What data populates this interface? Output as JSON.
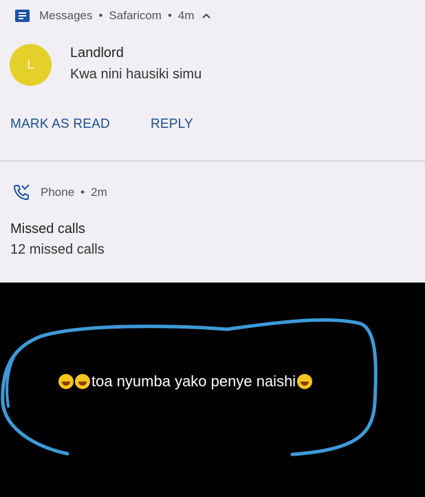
{
  "messages_notification": {
    "app_name": "Messages",
    "carrier": "Safaricom",
    "time": "4m",
    "expand_glyph": "^",
    "avatar_letter": "L",
    "sender": "Landlord",
    "message": "Kwa nini hausiki simu",
    "actions": [
      "MARK AS READ",
      "REPLY"
    ]
  },
  "phone_notification": {
    "app_name": "Phone",
    "time": "2m",
    "title": "Missed calls",
    "subtitle": "12 missed calls"
  },
  "caption": {
    "text": "toa nyumba yako penye naishi",
    "emoji": "grinning-squinting-face"
  },
  "colors": {
    "card_background": "#f1eff3",
    "action_blue": "#1b4e8f",
    "avatar_yellow": "#e4d02a",
    "scribble_blue": "#3d9ad8",
    "background": "#000000"
  }
}
